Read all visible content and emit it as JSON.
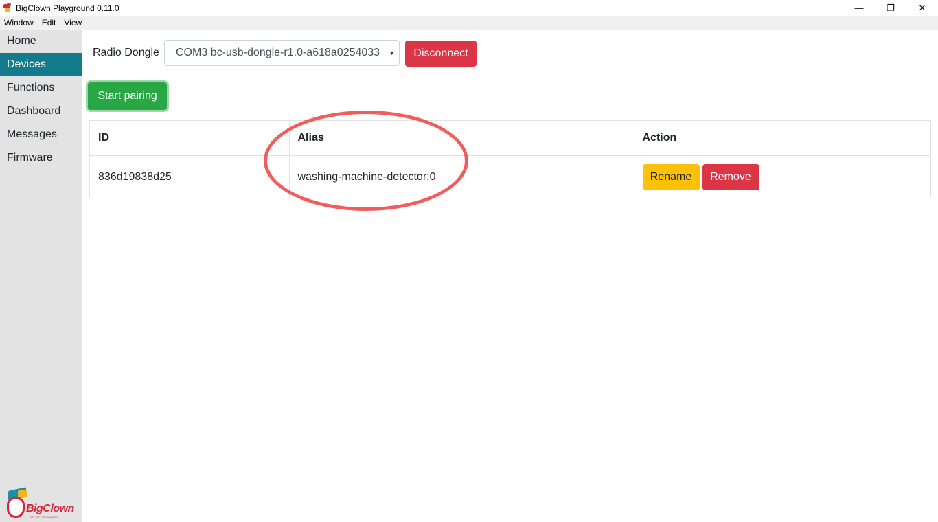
{
  "window": {
    "title": "BigClown Playground 0.11.0",
    "controls": {
      "minimize": "—",
      "restore": "❐",
      "close": "✕"
    }
  },
  "menubar": {
    "items": [
      "Window",
      "Edit",
      "View"
    ]
  },
  "sidebar": {
    "items": [
      {
        "label": "Home",
        "active": false
      },
      {
        "label": "Devices",
        "active": true
      },
      {
        "label": "Functions",
        "active": false
      },
      {
        "label": "Dashboard",
        "active": false
      },
      {
        "label": "Messages",
        "active": false
      },
      {
        "label": "Firmware",
        "active": false
      }
    ],
    "logo": {
      "text": "BigClown",
      "tagline": "IOT KIT FOR MAKERS"
    }
  },
  "main": {
    "dongle_label": "Radio Dongle",
    "dongle_selected": "COM3 bc-usb-dongle-r1.0-a618a0254033",
    "dongle_arrow": "▼",
    "disconnect_label": "Disconnect",
    "pairing_label": "Start pairing",
    "table": {
      "headers": [
        "ID",
        "Alias",
        "Action"
      ],
      "rows": [
        {
          "id": "836d19838d25",
          "alias": "washing-machine-detector:0",
          "rename_label": "Rename",
          "remove_label": "Remove"
        }
      ]
    }
  },
  "colors": {
    "accent": "#147b8c",
    "danger": "#dc3545",
    "success": "#28a745",
    "warning": "#ffc107",
    "annotation": "#f25c5c"
  }
}
